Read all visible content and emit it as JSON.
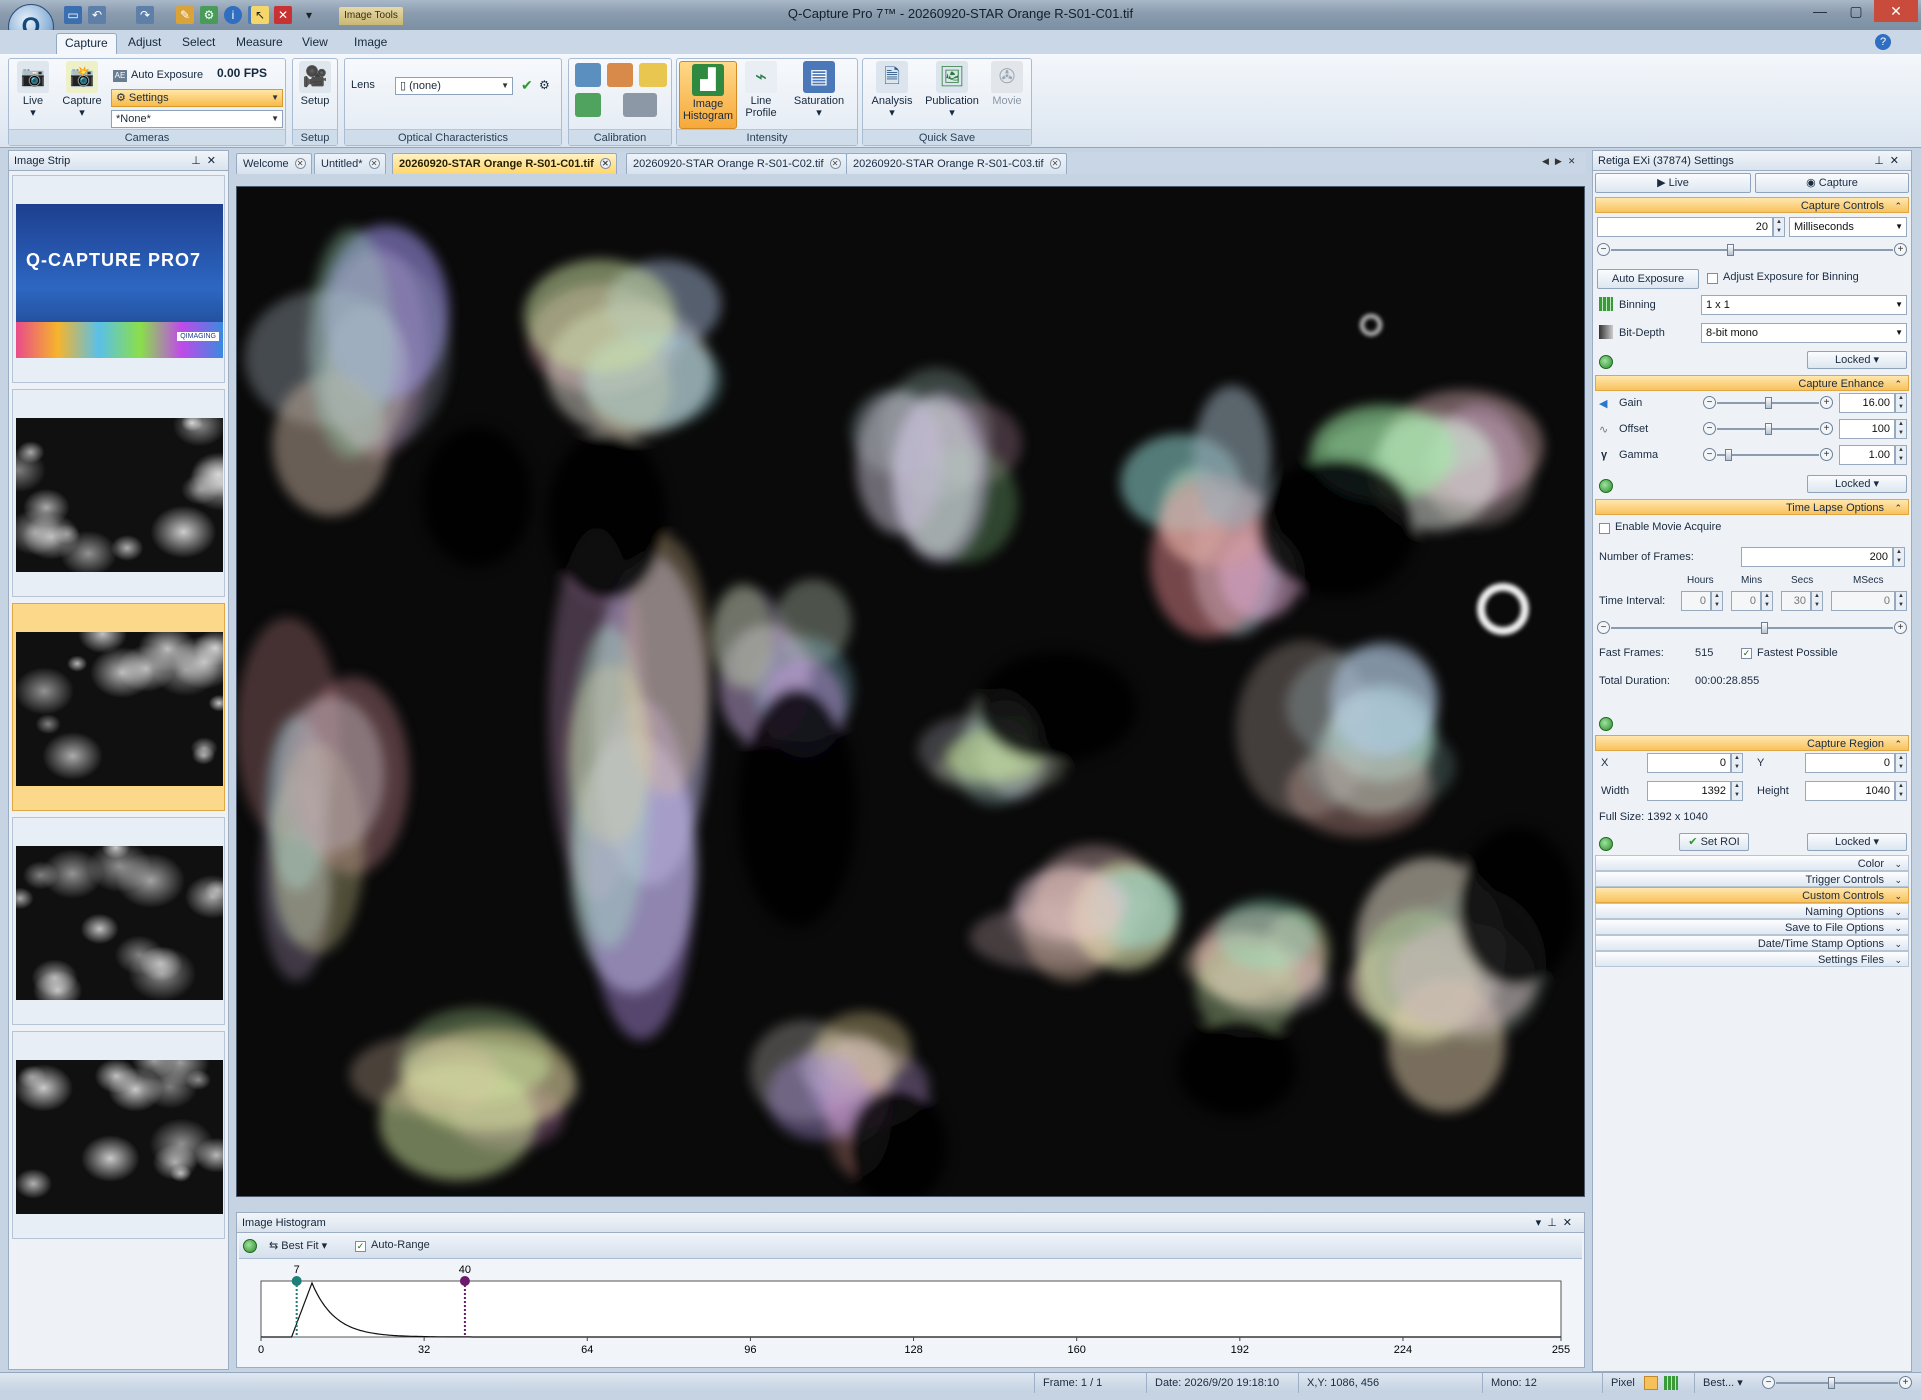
{
  "window": {
    "title": "Q-Capture Pro 7™ - 20260920-STAR Orange R-S01-C01.tif",
    "context_tab": "Image Tools"
  },
  "ribbon": {
    "tabs": [
      "Capture",
      "Adjust",
      "Select",
      "Measure",
      "View",
      "Image"
    ],
    "active_tab": "Capture",
    "cameras": {
      "live": "Live",
      "capture": "Capture",
      "auto_exposure": "Auto Exposure",
      "fps": "0.00 FPS",
      "settings": "Settings",
      "none": "*None*",
      "label": "Cameras"
    },
    "setup": {
      "button": "Setup",
      "label": "Setup"
    },
    "optical": {
      "lens_label": "Lens",
      "lens_value": "(none)",
      "label": "Optical Characteristics"
    },
    "calibration": {
      "label": "Calibration"
    },
    "intensity": {
      "histogram_line1": "Image",
      "histogram_line2": "Histogram",
      "profile_line1": "Line",
      "profile_line2": "Profile",
      "saturation": "Saturation",
      "label": "Intensity"
    },
    "quicksave": {
      "analysis": "Analysis",
      "publication": "Publication",
      "movie": "Movie",
      "label": "Quick Save"
    }
  },
  "image_strip": {
    "title": "Image Strip",
    "splash_title": "Q-CAPTURE PRO7",
    "splash_badge": "QIMAGING"
  },
  "doc_tabs": [
    "Welcome",
    "Untitled*",
    "20260920-STAR Orange R-S01-C01.tif",
    "20260920-STAR Orange R-S01-C02.tif",
    "20260920-STAR Orange R-S01-C03.tif"
  ],
  "histogram": {
    "title": "Image Histogram",
    "best_fit": "Best Fit",
    "auto_range": "Auto-Range",
    "marker_low": "7",
    "marker_high": "40",
    "ticks": [
      "0",
      "32",
      "64",
      "96",
      "128",
      "160",
      "192",
      "224",
      "255"
    ],
    "colors": {
      "low": "#1f7f7a",
      "high": "#6b1a6b"
    }
  },
  "settings": {
    "title": "Retiga EXi (37874) Settings",
    "live_tab": "Live",
    "capture_tab": "Capture",
    "capture_controls": {
      "header": "Capture Controls",
      "exposure": "20",
      "unit": "Milliseconds",
      "auto_exposure": "Auto Exposure",
      "adjust_binning": "Adjust Exposure for Binning",
      "binning_label": "Binning",
      "binning": "1 x 1",
      "bitdepth_label": "Bit-Depth",
      "bitdepth": "8-bit mono",
      "locked": "Locked"
    },
    "capture_enhance": {
      "header": "Capture Enhance",
      "gain_label": "Gain",
      "gain": "16.00",
      "offset_label": "Offset",
      "offset": "100",
      "gamma_label": "Gamma",
      "gamma": "1.00",
      "locked": "Locked"
    },
    "time_lapse": {
      "header": "Time Lapse Options",
      "enable_movie": "Enable Movie Acquire",
      "frames_label": "Number of Frames:",
      "frames": "200",
      "hours_h": "Hours",
      "mins_h": "Mins",
      "secs_h": "Secs",
      "msecs_h": "MSecs",
      "interval_label": "Time Interval:",
      "hours": "0",
      "mins": "0",
      "secs": "30",
      "msecs": "0",
      "fast_frames_label": "Fast Frames:",
      "fast_frames": "515",
      "fastest": "Fastest Possible",
      "total_label": "Total Duration:",
      "total": "00:00:28.855"
    },
    "capture_region": {
      "header": "Capture Region",
      "x_label": "X",
      "x": "0",
      "y_label": "Y",
      "y": "0",
      "width_label": "Width",
      "width": "1392",
      "height_label": "Height",
      "height": "1040",
      "full_size": "Full Size: 1392 x 1040",
      "set_roi": "Set ROI",
      "locked": "Locked"
    },
    "collapsed": [
      "Color",
      "Trigger Controls",
      "Custom Controls",
      "Naming Options",
      "Save to File Options",
      "Date/Time Stamp Options",
      "Settings Files"
    ]
  },
  "status": {
    "frame": "Frame: 1 / 1",
    "date": "Date: 2026/9/20 19:18:10",
    "xy": "X,Y: 1086,  456",
    "mono": "Mono:  12",
    "pixel": "Pixel",
    "zoom": "Best..."
  }
}
